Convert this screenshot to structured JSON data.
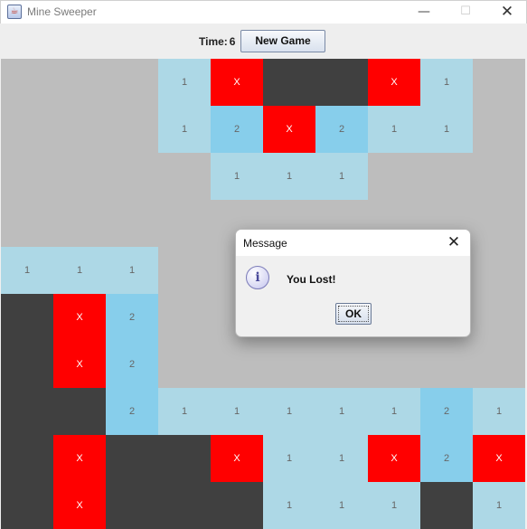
{
  "window": {
    "title": "Mine Sweeper",
    "app_icon": "java-cup-icon",
    "minimize_glyph": "—",
    "maximize_glyph": "☐",
    "close_glyph": "✕"
  },
  "toolbar": {
    "time_label": "Time:",
    "time_value": "6",
    "new_game_label": "New Game"
  },
  "board": {
    "colors": {
      "hidden": "#bdbdbd",
      "revealed_1": "#add8e6",
      "revealed_2": "#87ceeb",
      "mine": "#ff0000",
      "dark": "#404040"
    },
    "rows": [
      [
        "H",
        "H",
        "H",
        "1",
        "X",
        "D",
        "D",
        "X",
        "1",
        "H"
      ],
      [
        "H",
        "H",
        "H",
        "1",
        "2",
        "X",
        "2",
        "1",
        "1",
        "H"
      ],
      [
        "H",
        "H",
        "H",
        "H",
        "1",
        "1",
        "1",
        "H",
        "H",
        "H"
      ],
      [
        "H",
        "H",
        "H",
        "H",
        "H",
        "H",
        "H",
        "H",
        "H",
        "H"
      ],
      [
        "1",
        "1",
        "1",
        "H",
        "H",
        "H",
        "H",
        "H",
        "H",
        "H"
      ],
      [
        "D",
        "X",
        "2",
        "H",
        "H",
        "H",
        "H",
        "H",
        "H",
        "H"
      ],
      [
        "D",
        "X",
        "2",
        "H",
        "H",
        "H",
        "H",
        "H",
        "H",
        "H"
      ],
      [
        "D",
        "D",
        "2",
        "1",
        "1",
        "1",
        "1",
        "1",
        "2",
        "1"
      ],
      [
        "D",
        "X",
        "D",
        "D",
        "X",
        "1",
        "1",
        "X",
        "2",
        "X"
      ],
      [
        "D",
        "X",
        "D",
        "D",
        "D",
        "1",
        "1",
        "1",
        "D",
        "1"
      ]
    ]
  },
  "dialog": {
    "title": "Message",
    "close_glyph": "✕",
    "icon_glyph": "i",
    "message": "You Lost!",
    "ok_label": "OK"
  }
}
